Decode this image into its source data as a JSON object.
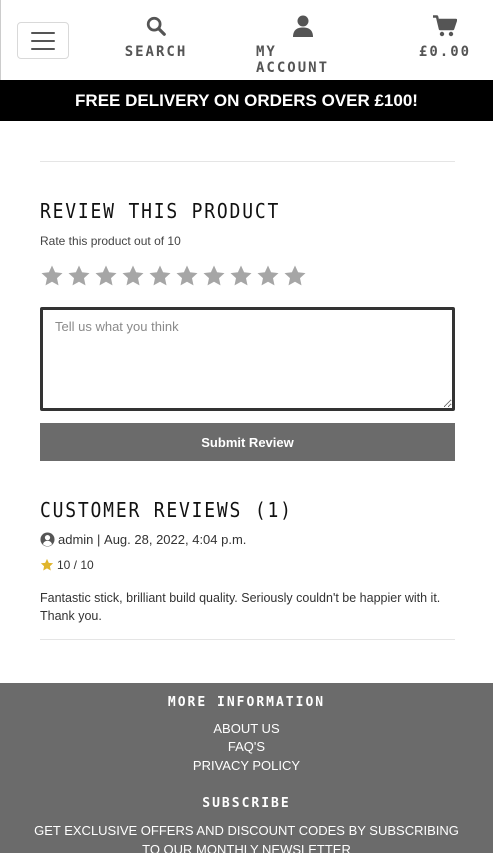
{
  "header": {
    "nav": {
      "search_label": "SEARCH",
      "account_label": "MY ACCOUNT",
      "cart_total": "£0.00"
    }
  },
  "banner": {
    "text": "FREE DELIVERY ON ORDERS OVER £100!"
  },
  "review_form": {
    "title": "REVIEW THIS PRODUCT",
    "rate_prompt": "Rate this product out of 10",
    "star_count": 10,
    "selected_rating": 0,
    "placeholder": "Tell us what you think",
    "submit_label": "Submit Review"
  },
  "reviews": {
    "title": "CUSTOMER REVIEWS (1)",
    "items": [
      {
        "author": "admin",
        "date": "Aug. 28, 2022, 4:04 p.m.",
        "rating": "10 / 10",
        "text": "Fantastic stick, brilliant build quality. Seriously couldn't be happier with it. Thank you."
      }
    ]
  },
  "footer": {
    "more_info_heading": "MORE INFORMATION",
    "links": [
      "ABOUT US",
      "FAQ'S",
      "PRIVACY POLICY"
    ],
    "subscribe_heading": "SUBSCRIBE",
    "subscribe_text": "GET EXCLUSIVE OFFERS AND DISCOUNT CODES BY SUBSCRIBING TO OUR MONTHLY NEWSLETTER"
  },
  "colors": {
    "banner_bg": "#000000",
    "button_bg": "#6b6b6b",
    "footer_bg": "#6b6b6b",
    "star_empty": "#a6a6a6",
    "star_filled": "#e0b52c"
  },
  "icons": {
    "menu": "hamburger-icon",
    "search": "search-icon",
    "account": "user-icon",
    "cart": "cart-icon",
    "reviewer": "user-circle-icon",
    "rating": "star-icon"
  }
}
